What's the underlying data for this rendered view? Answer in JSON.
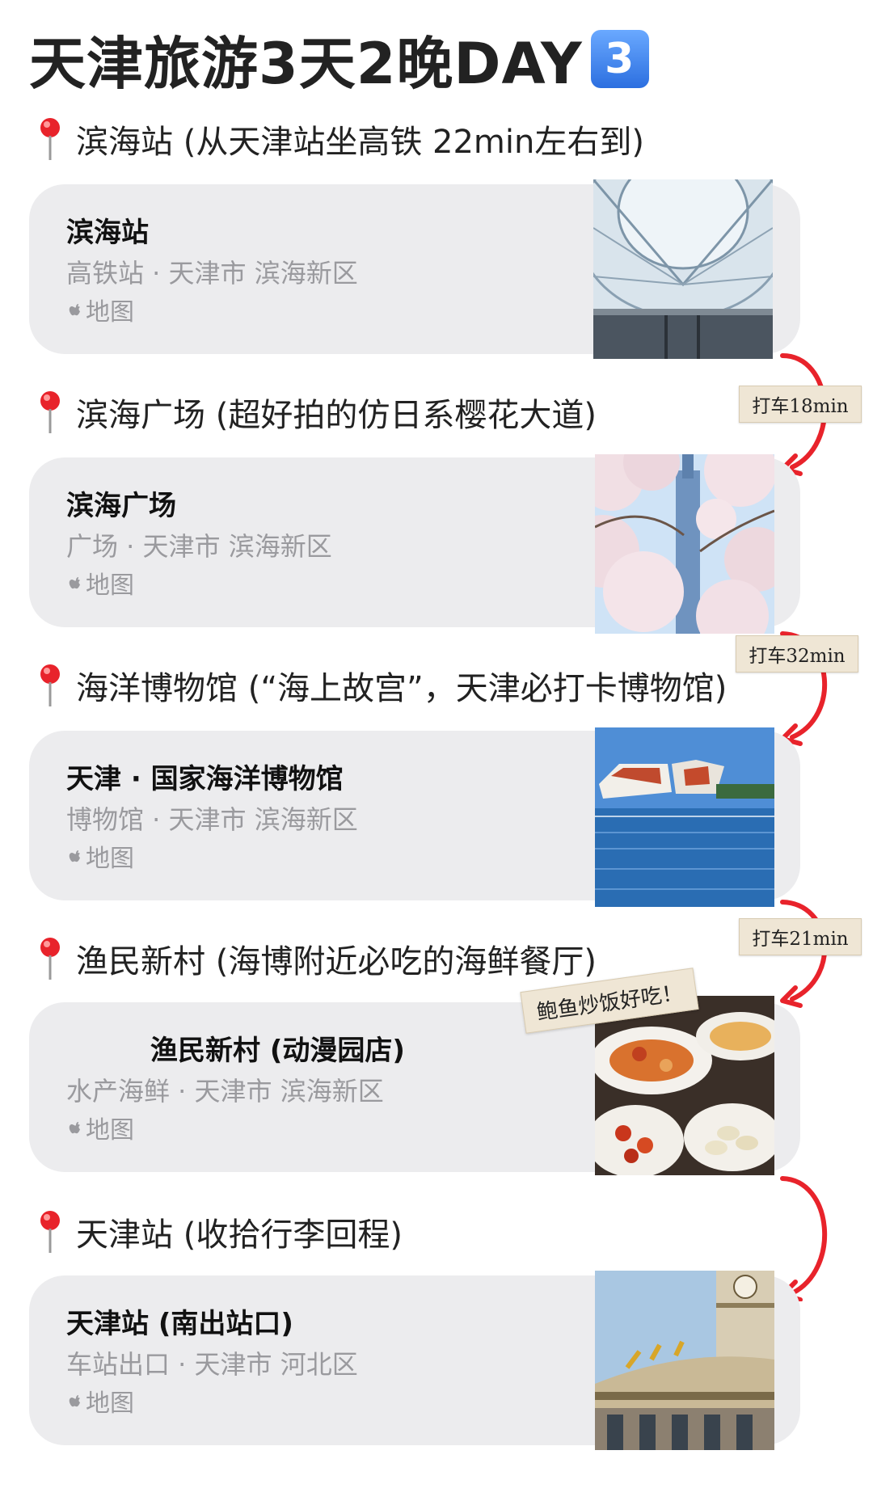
{
  "page": {
    "title": "天津旅游3天2晚DAY",
    "day_badge": "3"
  },
  "stops": [
    {
      "heading": "滨海站 (从天津站坐高铁 22min左右到)",
      "name": "滨海站",
      "category_location": "高铁站 · 天津市 滨海新区",
      "map_label": "地图"
    },
    {
      "heading": "滨海广场 (超好拍的仿日系樱花大道)",
      "name": "滨海广场",
      "category_location": "广场 · 天津市 滨海新区",
      "map_label": "地图"
    },
    {
      "heading": "海洋博物馆 (“海上故宫”，天津必打卡博物馆)",
      "name": "天津 · 国家海洋博物馆",
      "category_location": "博物馆 · 天津市 滨海新区",
      "map_label": "地图"
    },
    {
      "heading": "渔民新村 (海博附近必吃的海鲜餐厅)",
      "name": "渔民新村 (动漫园店)",
      "category_location": "水产海鲜 · 天津市 滨海新区",
      "map_label": "地图"
    },
    {
      "heading": "天津站 (收拾行李回程)",
      "name": "天津站 (南出站口)",
      "category_location": "车站出口 · 天津市 河北区",
      "map_label": "地图"
    }
  ],
  "transfers": [
    "打车18min",
    "打车32min",
    "打车21min"
  ],
  "photo_note": "鲍鱼炒饭好吃！",
  "colors": {
    "arrow": "#e8232b",
    "card_bg": "#ececee",
    "muted_text": "#9a9a9e",
    "tag_bg": "#efe6d5"
  },
  "icons": [
    "map-pin-icon",
    "apple-logo-icon"
  ]
}
